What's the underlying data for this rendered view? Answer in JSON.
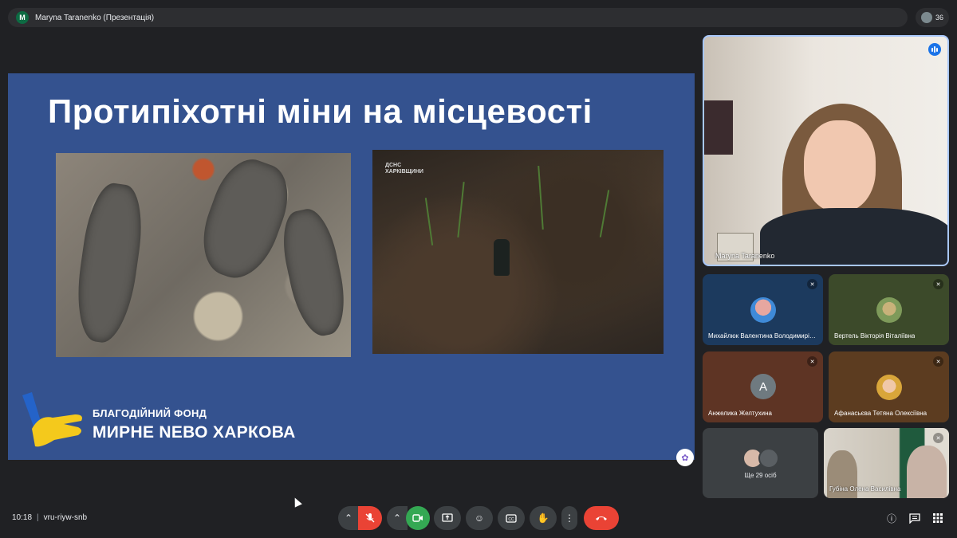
{
  "window": {
    "title": "Marуna Taranenko (Презентація)",
    "presenter_initial": "M",
    "participant_count": "36"
  },
  "slide": {
    "title": "Протипіхотні міни на місцевості",
    "watermark_line1": "ДСНС",
    "watermark_line2": "ХАРКІВЩИНИ",
    "foundation_line1": "БЛАГОДІЙНИЙ ФОНД",
    "foundation_line2": "МИРНЕ NЕВО ХАРКОВА",
    "colors": {
      "background": "#34528f",
      "flag_blue": "#2463c9",
      "flag_yellow": "#f4c91c"
    }
  },
  "speaker": {
    "name": "Marуna Taranenko"
  },
  "participants": [
    {
      "name": "Михайлюк Валентина Володимирі…",
      "muted": true
    },
    {
      "name": "Вертель Вікторія Віталіївна",
      "muted": true
    },
    {
      "name": "Анжелика Желтухина",
      "avatar_letter": "A",
      "muted": true
    },
    {
      "name": "Афанасьєва Тетяна Олексіївна",
      "muted": true
    },
    {
      "more_label": "Ще 29 осіб"
    },
    {
      "name": "Губіна Олена Василівна",
      "muted": true
    }
  ],
  "bottom_bar": {
    "time": "10:18",
    "meeting_code": "vru-riyw-snb"
  },
  "icons": {
    "mic": "mic-off-icon",
    "camera": "video-camera-icon",
    "present": "present-screen-icon",
    "emoji": "emoji-icon",
    "captions": "captions-icon",
    "hand": "raise-hand-icon",
    "more": "more-vert-icon",
    "end": "end-call-icon",
    "info": "info-icon",
    "chat": "chat-icon",
    "activities": "grid-icon"
  }
}
